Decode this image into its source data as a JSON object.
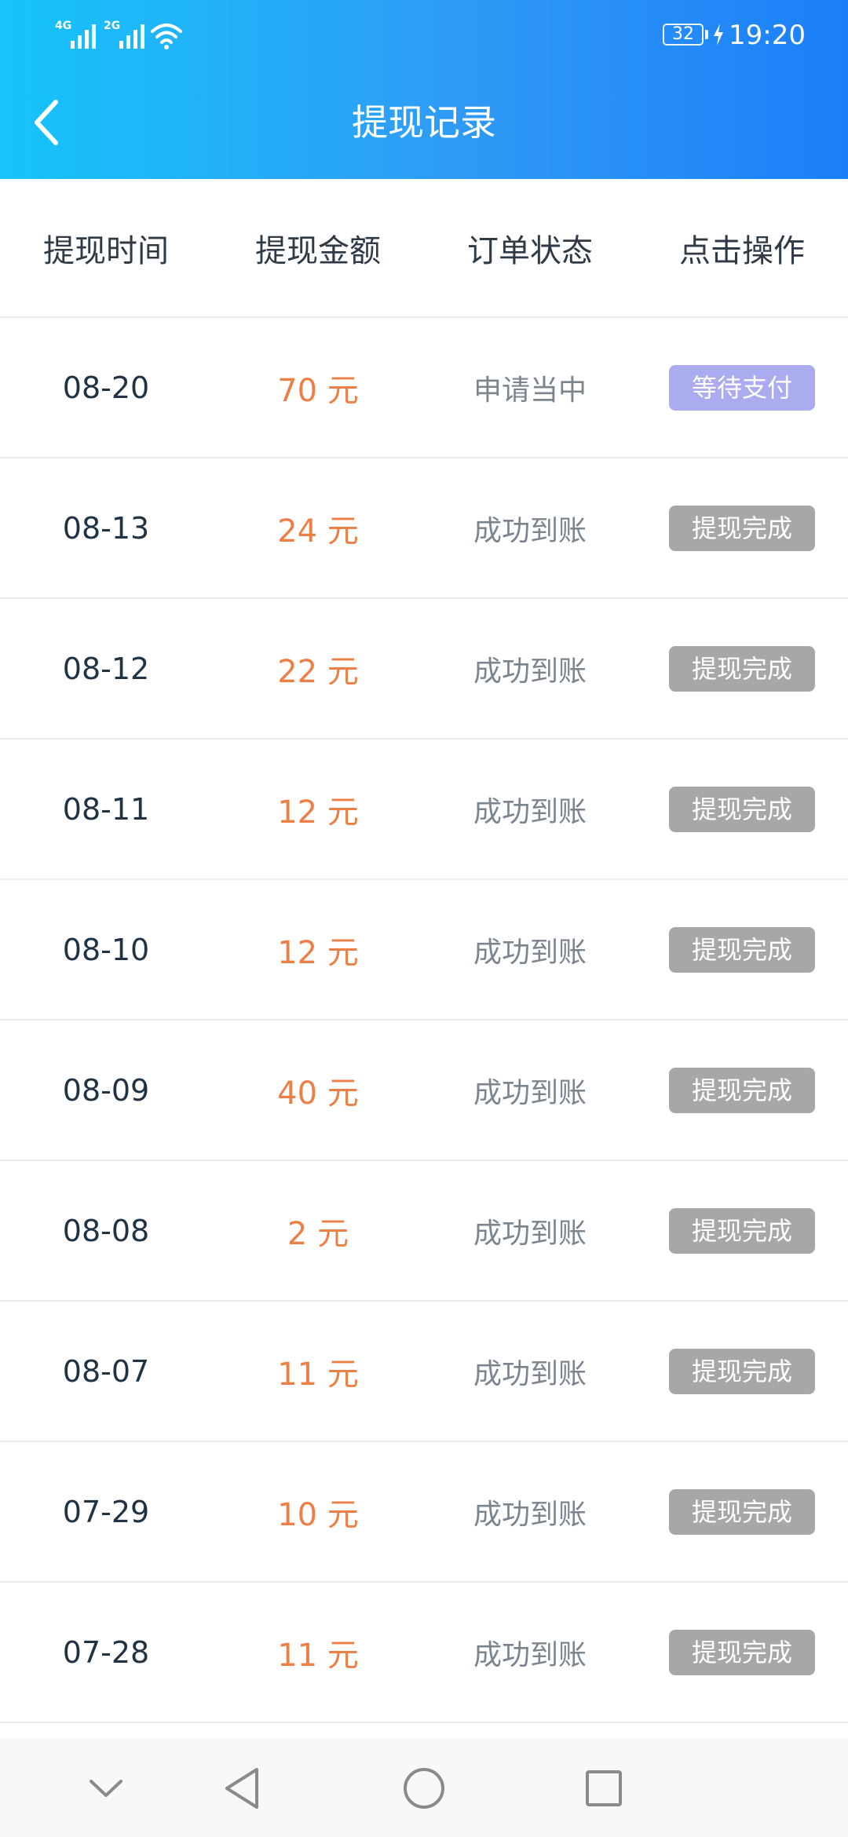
{
  "status_bar": {
    "network_1": "4G",
    "network_2": "2G",
    "battery_level": "32",
    "time": "19:20"
  },
  "header": {
    "title": "提现记录",
    "back_icon": "chevron-left-icon"
  },
  "table": {
    "columns": [
      "提现时间",
      "提现金额",
      "订单状态",
      "点击操作"
    ],
    "rows": [
      {
        "date": "08-20",
        "amount": "70 元",
        "status": "申请当中",
        "action": "等待支付",
        "pending": true
      },
      {
        "date": "08-13",
        "amount": "24 元",
        "status": "成功到账",
        "action": "提现完成",
        "pending": false
      },
      {
        "date": "08-12",
        "amount": "22 元",
        "status": "成功到账",
        "action": "提现完成",
        "pending": false
      },
      {
        "date": "08-11",
        "amount": "12 元",
        "status": "成功到账",
        "action": "提现完成",
        "pending": false
      },
      {
        "date": "08-10",
        "amount": "12 元",
        "status": "成功到账",
        "action": "提现完成",
        "pending": false
      },
      {
        "date": "08-09",
        "amount": "40 元",
        "status": "成功到账",
        "action": "提现完成",
        "pending": false
      },
      {
        "date": "08-08",
        "amount": "2 元",
        "status": "成功到账",
        "action": "提现完成",
        "pending": false
      },
      {
        "date": "08-07",
        "amount": "11 元",
        "status": "成功到账",
        "action": "提现完成",
        "pending": false
      },
      {
        "date": "07-29",
        "amount": "10 元",
        "status": "成功到账",
        "action": "提现完成",
        "pending": false
      },
      {
        "date": "07-28",
        "amount": "11 元",
        "status": "成功到账",
        "action": "提现完成",
        "pending": false
      }
    ]
  },
  "nav_bar": {
    "icons": [
      "chevron-down-icon",
      "back-triangle-icon",
      "home-circle-icon",
      "recents-square-icon"
    ]
  },
  "colors": {
    "header_gradient_start": "#16c4fb",
    "header_gradient_end": "#1b7ff9",
    "amount": "#ec7f45",
    "pending_button": "#ababf0",
    "done_button": "#a7a7a7"
  }
}
